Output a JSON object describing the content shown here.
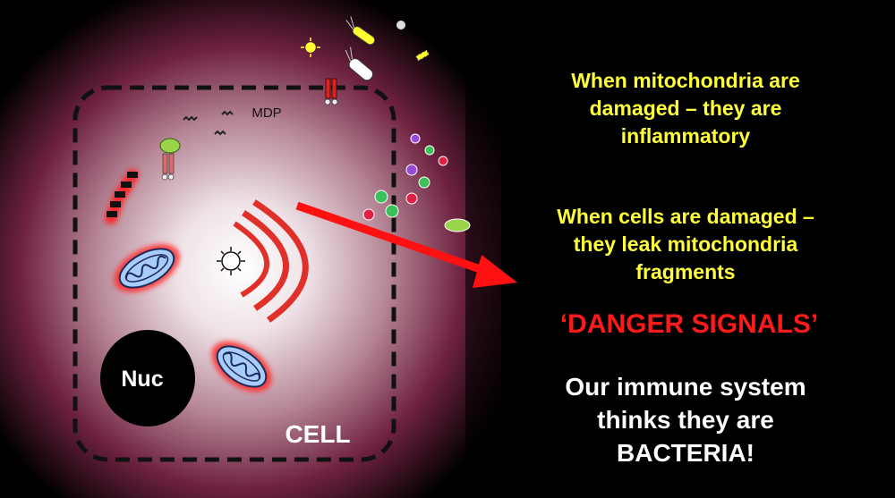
{
  "labels": {
    "mdp": "MDP",
    "nucleus": "Nuc",
    "cell": "CELL"
  },
  "statements": {
    "mitochondria_damaged_line1": "When mitochondria are",
    "mitochondria_damaged_line2": "damaged – they are",
    "mitochondria_damaged_line3": "inflammatory",
    "cells_damaged_line1": "When cells are damaged –",
    "cells_damaged_line2": "they leak mitochondria",
    "cells_damaged_line3": "fragments",
    "danger_signals": "‘DANGER SIGNALS’",
    "immune_line1": "Our immune system",
    "immune_line2": "thinks they are",
    "immune_line3": "BACTERIA!"
  },
  "colors": {
    "background": "#000000",
    "statement_yellow": "#ffff3a",
    "danger_red": "#ff1a1a",
    "arrow_red": "#ff1111",
    "membrane": "#111111",
    "cell_glow": "#7a1f3a",
    "mito_blue": "#9ec6ff"
  }
}
